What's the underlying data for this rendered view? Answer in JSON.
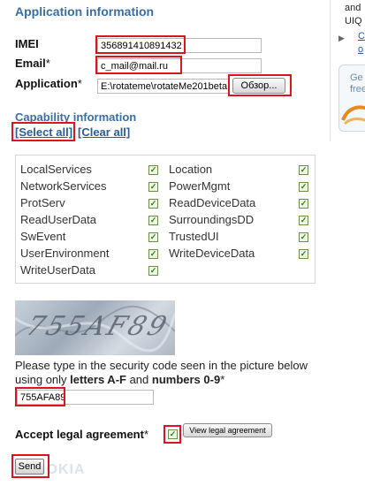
{
  "form": {
    "title": "Application information",
    "imei_label": "IMEI",
    "imei_value": "356891410891432",
    "email_label": "Email",
    "email_required": "*",
    "email_value": "c_mail@mail.ru",
    "application_label": "Application",
    "application_required": "*",
    "application_value": "E:\\rotateme\\rotateMe201beta",
    "browse_label": "Обзор..."
  },
  "capability": {
    "title": "Capability information",
    "select_all": "[Select all]",
    "clear_all": "[Clear all]",
    "left": [
      "LocalServices",
      "NetworkServices",
      "ProtServ",
      "ReadUserData",
      "SwEvent",
      "UserEnvironment",
      "WriteUserData"
    ],
    "right": [
      "Location",
      "PowerMgmt",
      "ReadDeviceData",
      "SurroundingsDD",
      "TrustedUI",
      "WriteDeviceData"
    ],
    "checked": true,
    "checkbox_color": "#2f7a16"
  },
  "security": {
    "captcha_text": "755AF89",
    "instruction_part1": "Please type in the security code seen in the picture below using only ",
    "letters": "letters A-F",
    "and": " and ",
    "numbers": "numbers 0-9",
    "asterisk": "*",
    "code_value": "755AFA89"
  },
  "legal": {
    "label": "Accept legal agreement",
    "required": "*",
    "checked": true,
    "view_button": "View legal agreement"
  },
  "send_button": "Send",
  "watermark": "NOKIA",
  "sidebar": {
    "line1": "and",
    "line2": "UIQ",
    "link1": "C",
    "link2": "o",
    "promo_line1": "Ge",
    "promo_line2": "free"
  },
  "colors": {
    "heading": "#3a6ea5",
    "highlight": "#d9161e",
    "link": "#2a5c9a"
  }
}
